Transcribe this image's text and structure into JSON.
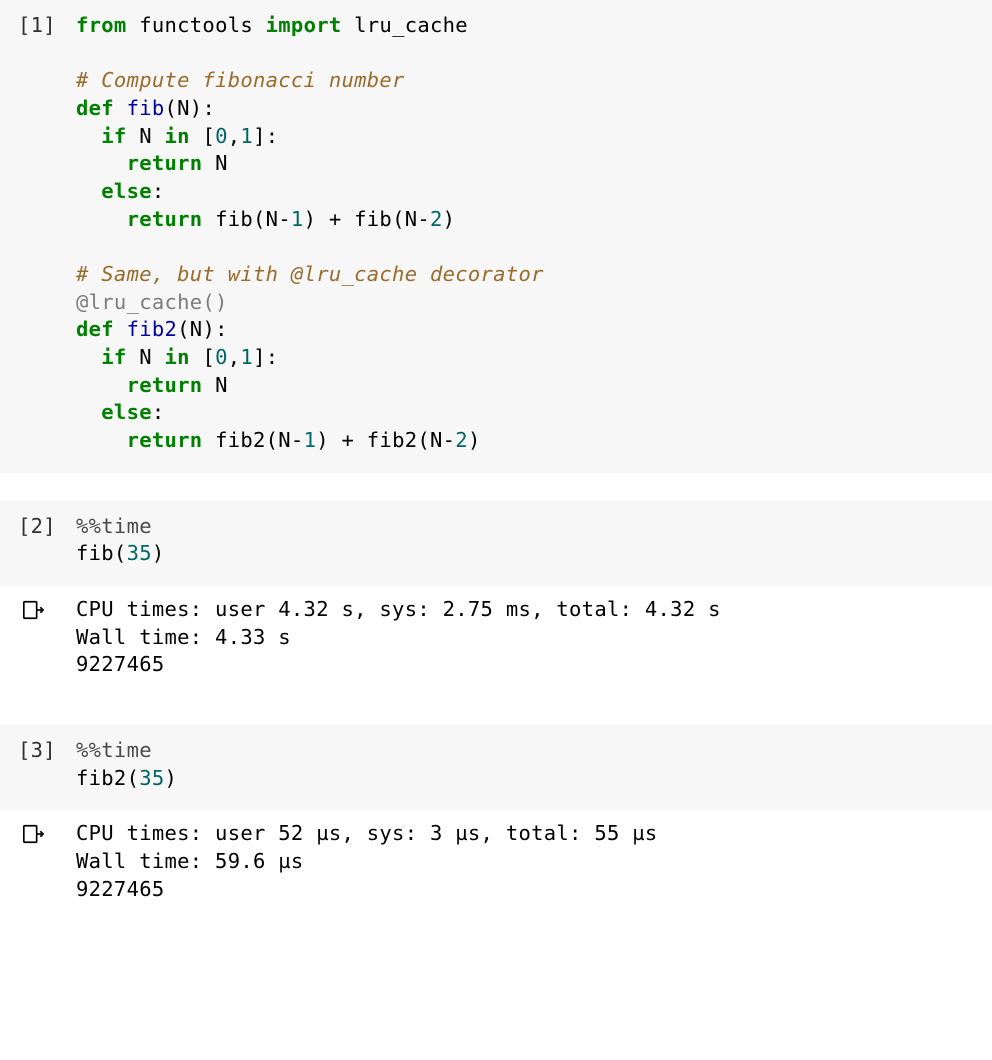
{
  "cells": [
    {
      "prompt": "[1]",
      "code": {
        "l0_from": "from",
        "l0_mod": " functools ",
        "l0_import": "import",
        "l0_name": " lru_cache",
        "l2_cmt": "# Compute fibonacci number",
        "l3_def": "def",
        "l3_fn": " fib",
        "l3_rest": "(N):",
        "l4_if": "  if",
        "l4_mid": " N ",
        "l4_in": "in",
        "l4_open": " [",
        "l4_n0": "0",
        "l4_comma": ",",
        "l4_n1": "1",
        "l4_close": "]:",
        "l5_ret": "    return",
        "l5_body": " N",
        "l6_else": "  else",
        "l6_colon": ":",
        "l7_ret": "    return",
        "l7_a": " fib(N-",
        "l7_n1": "1",
        "l7_b": ") + fib(N-",
        "l7_n2": "2",
        "l7_c": ")",
        "l9_cmt": "# Same, but with @lru_cache decorator",
        "l10_dec": "@lru_cache()",
        "l11_def": "def",
        "l11_fn": " fib2",
        "l11_rest": "(N):",
        "l12_if": "  if",
        "l12_mid": " N ",
        "l12_in": "in",
        "l12_open": " [",
        "l12_n0": "0",
        "l12_comma": ",",
        "l12_n1": "1",
        "l12_close": "]:",
        "l13_ret": "    return",
        "l13_body": " N",
        "l14_else": "  else",
        "l14_colon": ":",
        "l15_ret": "    return",
        "l15_a": " fib2(N-",
        "l15_n1": "1",
        "l15_b": ") + fib2(N-",
        "l15_n2": "2",
        "l15_c": ")"
      }
    },
    {
      "prompt": "[2]",
      "code": {
        "magic": "%%time",
        "call_fn": "fib(",
        "call_n": "35",
        "call_close": ")"
      },
      "output": {
        "line1": "CPU times: user 4.32 s, sys: 2.75 ms, total: 4.32 s",
        "line2": "Wall time: 4.33 s",
        "line3": "9227465"
      }
    },
    {
      "prompt": "[3]",
      "code": {
        "magic": "%%time",
        "call_fn": "fib2(",
        "call_n": "35",
        "call_close": ")"
      },
      "output": {
        "line1": "CPU times: user 52 µs, sys: 3 µs, total: 55 µs",
        "line2": "Wall time: 59.6 µs",
        "line3": "9227465"
      }
    }
  ]
}
